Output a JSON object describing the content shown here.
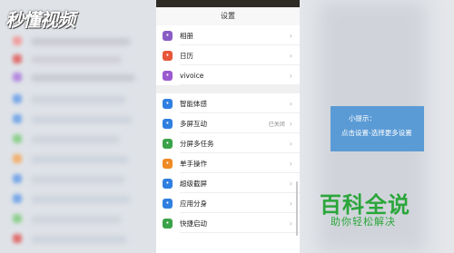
{
  "branding": {
    "watermark": "秒懂视频",
    "baike_title": "百科全说",
    "baike_subtitle": "助你轻松解决"
  },
  "phone": {
    "header_title": "设置",
    "group1": [
      {
        "label": "相册",
        "icon": "photos-icon",
        "color": "#8a5cc6",
        "value": ""
      },
      {
        "label": "日历",
        "icon": "calendar-icon",
        "color": "#e8563a",
        "value": ""
      },
      {
        "label": "vivoice",
        "icon": "microphone-icon",
        "color": "#9b59d0",
        "value": ""
      }
    ],
    "group2": [
      {
        "label": "智能体感",
        "icon": "smart-motion-icon",
        "color": "#2f7fe0",
        "value": ""
      },
      {
        "label": "多屏互动",
        "icon": "multi-screen-icon",
        "color": "#2f7fe0",
        "value": "已关闭"
      },
      {
        "label": "分屏多任务",
        "icon": "split-screen-icon",
        "color": "#3aa34a",
        "value": ""
      },
      {
        "label": "单手操作",
        "icon": "one-hand-icon",
        "color": "#f08a24",
        "value": ""
      },
      {
        "label": "超级截屏",
        "icon": "screenshot-icon",
        "color": "#2f7fe0",
        "value": ""
      },
      {
        "label": "应用分身",
        "icon": "app-clone-icon",
        "color": "#2f7fe0",
        "value": ""
      },
      {
        "label": "快捷启动",
        "icon": "quick-launch-icon",
        "color": "#3aa34a",
        "value": ""
      }
    ]
  },
  "tip": {
    "title": "小提示：",
    "body": "点击设置-选择更多设置"
  }
}
